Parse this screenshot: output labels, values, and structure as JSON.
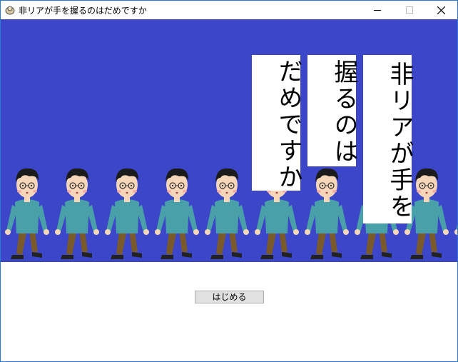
{
  "window": {
    "title": "非リアが手を握るのはだめですか"
  },
  "panels": [
    "非リアが手を",
    "握るのは",
    "だめですか"
  ],
  "start_button": {
    "label": "はじめる"
  },
  "colors": {
    "background": "#3c46c8",
    "shirt": "#4aa0a8",
    "pants": "#7a5a2a"
  }
}
